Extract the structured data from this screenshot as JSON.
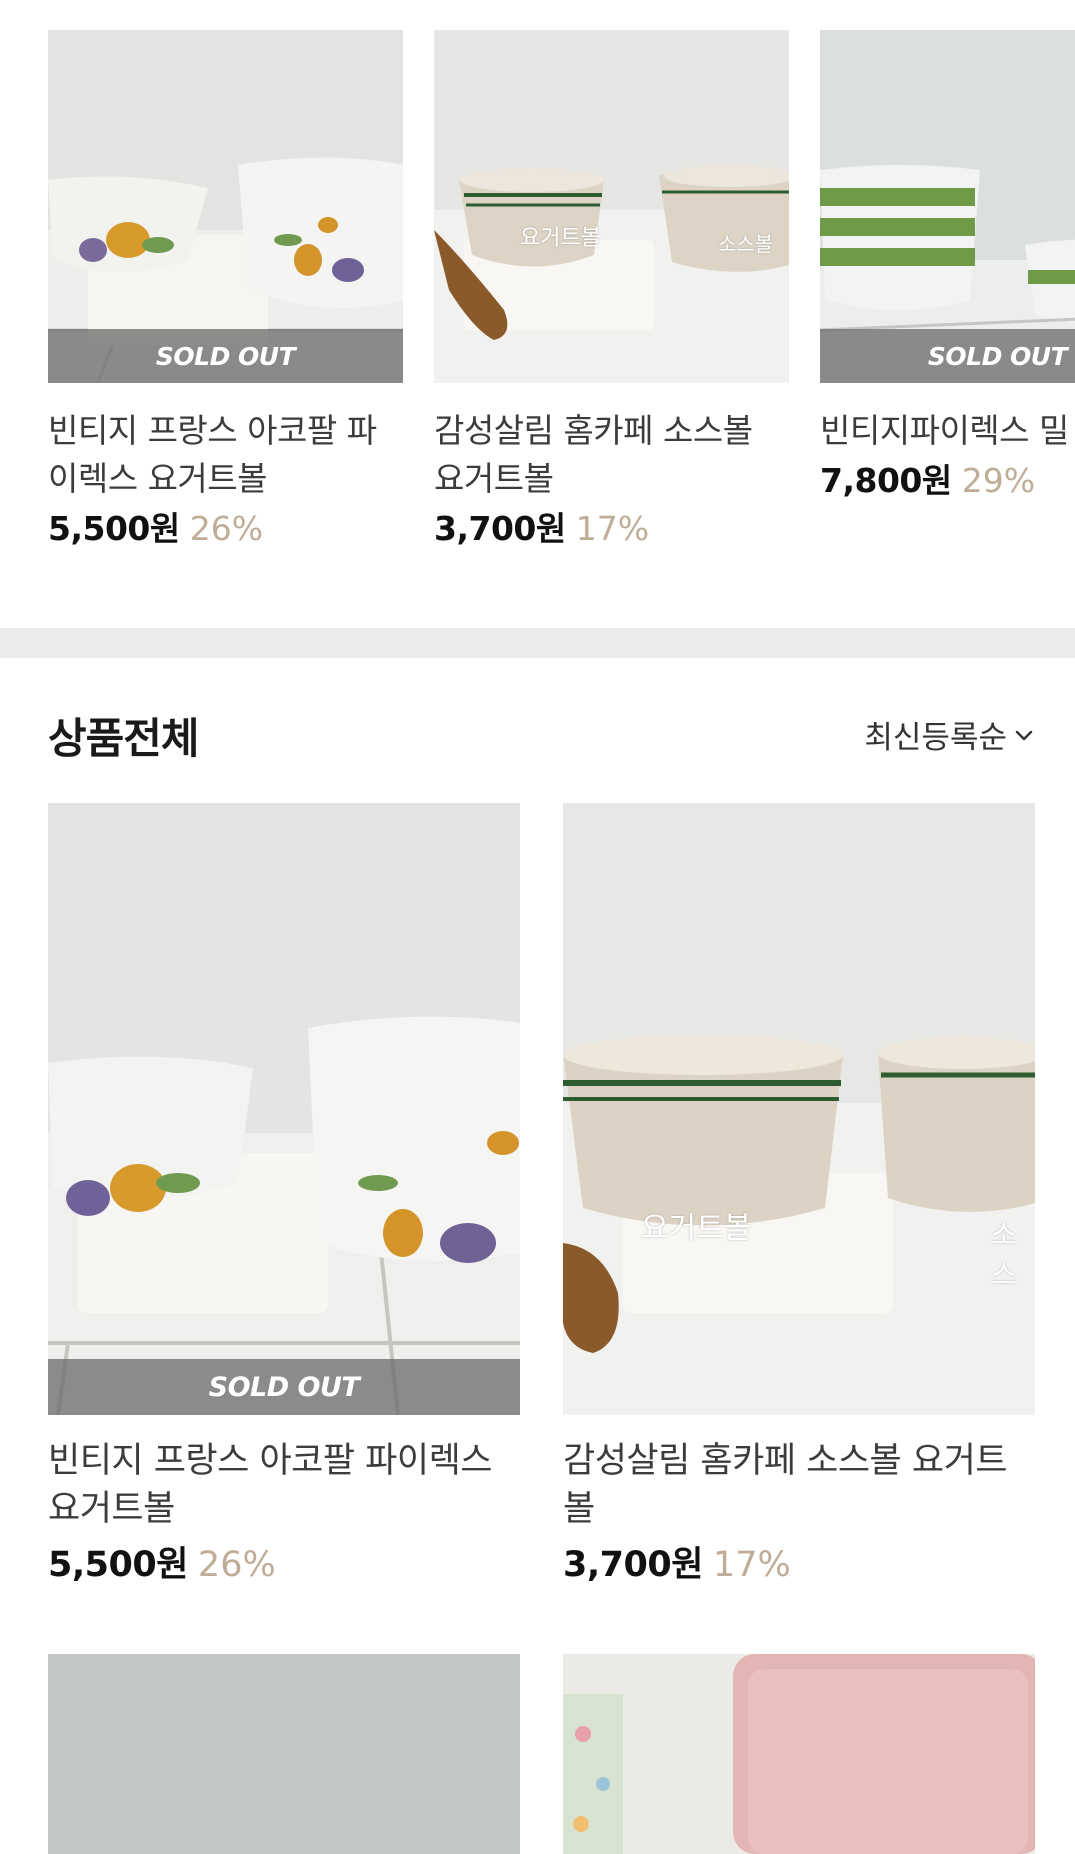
{
  "carousel": {
    "items": [
      {
        "title": "빈티지 프랑스 아코팔 파이렉스 요거트볼",
        "price": "5,500원",
        "discount": "26%",
        "sold_out": "SOLD OUT"
      },
      {
        "title": "감성살림 홈카페 소스볼 요거트볼",
        "price": "3,700원",
        "discount": "17%",
        "label_left": "요거트볼",
        "label_right": "소스볼"
      },
      {
        "title": "빈티지파이렉스 밀",
        "price": "7,800원",
        "discount": "29%",
        "sold_out": "SOLD OUT"
      }
    ]
  },
  "section": {
    "title": "상품전체",
    "sort_label": "최신등록순"
  },
  "grid": {
    "items": [
      {
        "title": "빈티지 프랑스 아코팔 파이렉스 요거트볼",
        "price": "5,500원",
        "discount": "26%",
        "sold_out": "SOLD OUT"
      },
      {
        "title": "감성살림 홈카페 소스볼 요거트볼",
        "price": "3,700원",
        "discount": "17%",
        "label_left": "요거트볼",
        "label_right": "소스"
      }
    ]
  },
  "colors": {
    "discount": "#c0ad98",
    "price": "#111111",
    "divider": "#eaeced"
  },
  "icons": {
    "sort": "chevron-down-icon"
  }
}
